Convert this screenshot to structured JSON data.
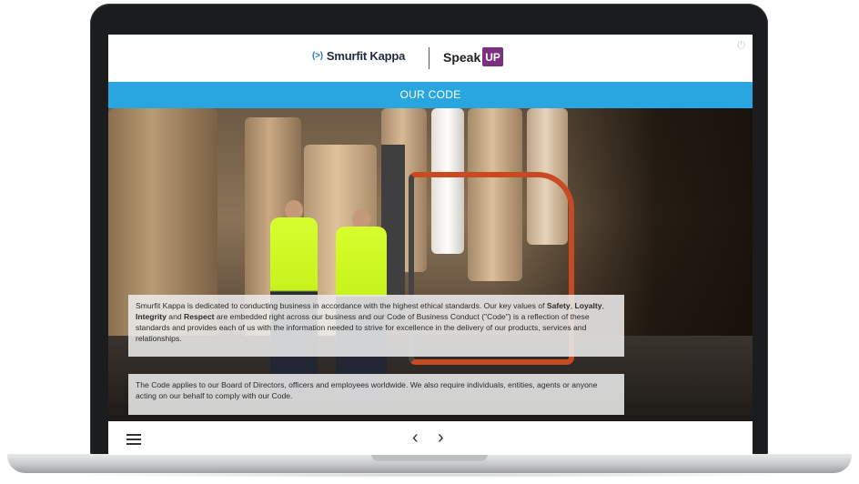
{
  "header": {
    "brand_mark": "(>)",
    "brand_name": "Smurfit Kappa",
    "speak": "Speak",
    "up": "UP",
    "power_icon": "⏻"
  },
  "bluebar": {
    "title": "OUR CODE"
  },
  "panels": {
    "p1_a": "Smurfit Kappa is dedicated to conducting business in accordance with the highest ethical standards. Our key values of ",
    "safety": "Safety",
    "loyalty": "Loyalty",
    "integrity": "Integrity",
    "and": "and",
    "respect": "Respect",
    "p1_b": " are embedded right across our business and our Code of Business Conduct (\"Code\") is a reflection of these standards and provides each of us with the information needed to strive for excellence in the delivery of our products, services and relationships.",
    "p2": "The Code applies to our Board of Directors, officers and employees worldwide. We also require individuals, entities, agents or anyone acting on our behalf to comply with our Code."
  },
  "nav": {
    "prev": "‹",
    "next": "›"
  },
  "colors": {
    "accent_blue": "#29a6e0",
    "up_purple": "#7b2f7e"
  }
}
